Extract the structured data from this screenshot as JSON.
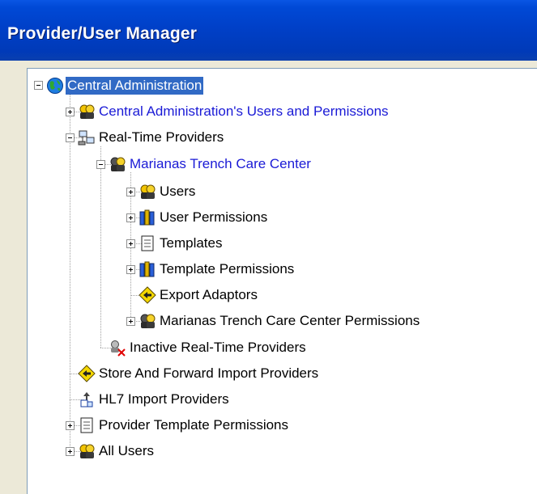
{
  "window": {
    "title": "Provider/User Manager"
  },
  "tree": {
    "root": {
      "label": "Central Administration"
    },
    "ca_users": {
      "label": "Central Administration's Users and Permissions"
    },
    "realtime": {
      "label": "Real-Time Providers"
    },
    "marianas": {
      "label": "Marianas Trench Care Center"
    },
    "users": {
      "label": "Users"
    },
    "user_permissions": {
      "label": "User Permissions"
    },
    "templates": {
      "label": "Templates"
    },
    "template_permissions": {
      "label": "Template Permissions"
    },
    "export_adaptors": {
      "label": "Export Adaptors"
    },
    "mtcc_permissions": {
      "label": "Marianas Trench Care Center Permissions"
    },
    "inactive": {
      "label": "Inactive Real-Time Providers"
    },
    "store_forward": {
      "label": "Store And Forward Import Providers"
    },
    "hl7": {
      "label": "HL7 Import Providers"
    },
    "provider_template_permissions": {
      "label": "Provider Template Permissions"
    },
    "all_users": {
      "label": "All Users"
    }
  },
  "colors": {
    "selection": "#316ac5",
    "link_blue": "#1a1ad6",
    "titlebar": "#0040c8"
  }
}
